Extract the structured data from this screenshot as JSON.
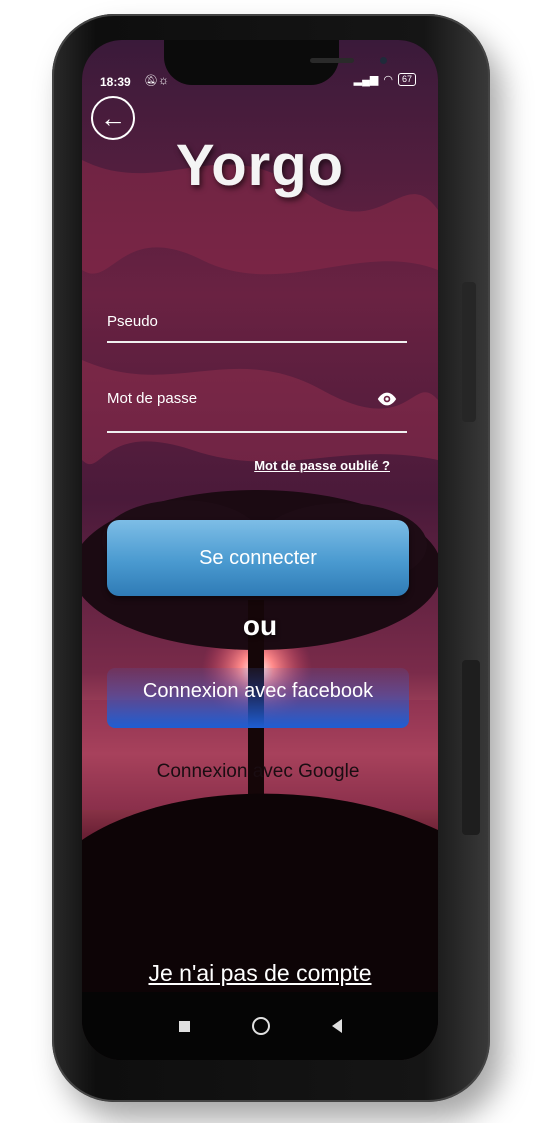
{
  "status": {
    "time": "18:39",
    "battery": "67",
    "left_icons": [
      "mute-icon",
      "brightness-icon"
    ],
    "right_icons": [
      "signal-icon",
      "wifi-icon"
    ]
  },
  "header": {
    "back_icon": "arrow-left-icon",
    "title": "Yorgo"
  },
  "form": {
    "username_label": "Pseudo",
    "password_label": "Mot de passe",
    "password_toggle_icon": "eye-icon",
    "forgot_link": "Mot de passe oublié ?"
  },
  "actions": {
    "login_label": "Se connecter",
    "separator": "ou",
    "facebook_label": "Connexion avec facebook",
    "google_label": "Connexion avec Google",
    "no_account_link": "Je n'ai pas de compte"
  },
  "nav": {
    "icons": [
      "recents-square-icon",
      "home-circle-icon",
      "back-triangle-icon"
    ]
  },
  "colors": {
    "login_button": "#4a9ad0",
    "facebook_button": "#1e5ed2",
    "sky": "#5a2040",
    "sunset": "#d0406a"
  }
}
